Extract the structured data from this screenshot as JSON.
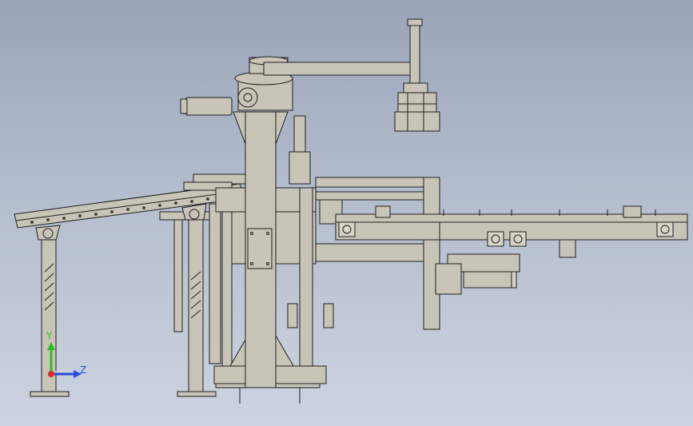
{
  "window": {
    "title": ""
  },
  "viewport": {
    "background_top": "#9aa4b8",
    "background_bottom": "#cdd3df",
    "model_color": "#c8c4b8",
    "edge_color": "#1e1e1e",
    "view": "side"
  },
  "triad": {
    "y_label": "Y",
    "z_label": "Z",
    "y_color": "#2bbf2b",
    "z_color": "#2a4cd8",
    "x_color": "#d82a2a"
  }
}
